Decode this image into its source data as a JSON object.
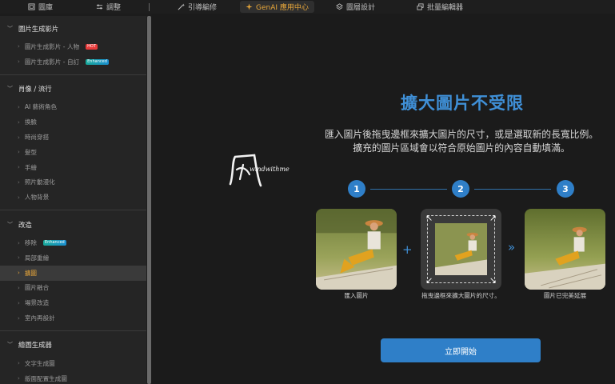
{
  "tabs": [
    {
      "label": "圖庫",
      "icon": "gallery-icon"
    },
    {
      "label": "調整",
      "icon": "adjust-icon"
    },
    {
      "label": "引導編修",
      "icon": "wand-icon"
    },
    {
      "label": "GenAI 應用中心",
      "icon": "sparkle-icon",
      "active": true
    },
    {
      "label": "圖層設計",
      "icon": "layers-icon"
    },
    {
      "label": "批量編輯器",
      "icon": "batch-icon"
    }
  ],
  "sidebar": {
    "sections": [
      {
        "title": "圖片生成影片",
        "items": [
          {
            "label": "圖片生成影片 - 人物",
            "badge": "HOT"
          },
          {
            "label": "圖片生成影片 - 自訂",
            "badge": "Enhanced"
          }
        ]
      },
      {
        "title": "肖像 / 流行",
        "items": [
          {
            "label": "AI 藝術角色"
          },
          {
            "label": "換臉"
          },
          {
            "label": "時尚穿搭"
          },
          {
            "label": "髮型"
          },
          {
            "label": "手繪"
          },
          {
            "label": "照片動漫化"
          },
          {
            "label": "人物背景"
          }
        ]
      },
      {
        "title": "改造",
        "items": [
          {
            "label": "移除",
            "badge": "Enhanced"
          },
          {
            "label": "局部重繪"
          },
          {
            "label": "擴圖",
            "active": true
          },
          {
            "label": "圖片融合"
          },
          {
            "label": "場景改造"
          },
          {
            "label": "室內再設計"
          }
        ]
      },
      {
        "title": "繪圖生成器",
        "items": [
          {
            "label": "文字生成圖"
          },
          {
            "label": "版面配置生成圖"
          }
        ]
      }
    ]
  },
  "main": {
    "logo_text": "windwithme",
    "title": "擴大圖片不受限",
    "desc_line1": "匯入圖片後拖曳邊框來擴大圖片的尺寸，或是選取新的長寬比例。",
    "desc_line2": "擴充的圖片區域會以符合原始圖片的內容自動填滿。",
    "steps": [
      "1",
      "2",
      "3"
    ],
    "caption1": "匯入圖片",
    "caption2": "拖曳邊框來擴大圖片的尺寸。",
    "caption3": "圖片已完美延展",
    "plus": "+",
    "arrows": "»",
    "start_button": "立即開始"
  },
  "colors": {
    "accent": "#3f8fd6",
    "active_tab": "#e8a73a",
    "hot": "#e83a3a"
  }
}
